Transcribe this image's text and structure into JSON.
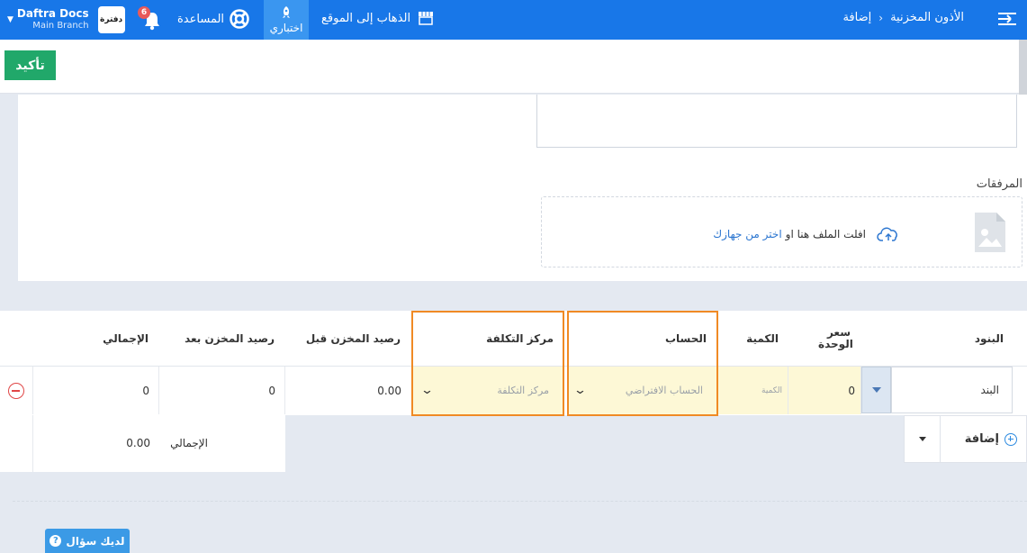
{
  "topbar": {
    "breadcrumb_parent": "الأذون المخزنية",
    "breadcrumb_current": "إضافة",
    "goto_site": "الذهاب إلى الموقع",
    "explore": "اختباري",
    "help": "المساعدة",
    "notifications_count": "6",
    "company_name": "Daftra Docs",
    "branch": "Main Branch",
    "logo_text": "دفترة",
    "accent": "#1877e8"
  },
  "actions": {
    "confirm": "تأكيد"
  },
  "attachments": {
    "label": "المرفقات",
    "drop_text": "افلت الملف هنا او",
    "choose_link": "اختر من جهازك"
  },
  "table": {
    "headers": {
      "items": "البنود",
      "unit_price": "سعر الوحدة",
      "quantity": "الكمية",
      "account": "الحساب",
      "cost_center": "مركز التكلفة",
      "stock_before": "رصيد المخزن قبل",
      "stock_after": "رصيد المخزن بعد",
      "total": "الإجمالي"
    },
    "row": {
      "item": "البند",
      "unit_price": "0",
      "quantity_placeholder": "الكمية",
      "account": "الحساب الافتراضي",
      "cost_center": "مركز التكلفة",
      "stock_before": "0.00",
      "stock_after": "0",
      "total": "0"
    }
  },
  "footer": {
    "add_label": "إضافة",
    "total_label": "الإجمالي",
    "total_value": "0.00",
    "question": "لديك سؤال"
  }
}
